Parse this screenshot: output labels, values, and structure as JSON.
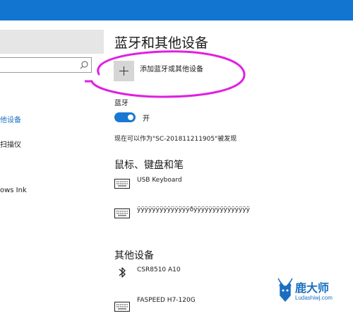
{
  "sidebar": {
    "items": [
      {
        "label": "他设备",
        "active": true
      },
      {
        "label": "扫描仪",
        "active": false
      },
      {
        "label": "ows Ink",
        "active": false
      }
    ]
  },
  "page": {
    "title": "蓝牙和其他设备",
    "add_device_label": "添加蓝牙或其他设备",
    "bluetooth_label": "蓝牙",
    "toggle_state": "开",
    "discoverable_text": "现在可以作为\"SC-201811211905\"被发现"
  },
  "sections": {
    "mouse_keyboard_pen": {
      "heading": "鼠标、键盘和笔",
      "devices": [
        {
          "name": "USB Keyboard",
          "icon": "keyboard-icon"
        },
        {
          "name": "ÿÿÿÿÿÿÿÿÿÿÿÿÿÿðÿÿÿÿÿÿÿÿÿÿÿÿÿÿÿ",
          "icon": "keyboard-icon"
        }
      ]
    },
    "other_devices": {
      "heading": "其他设备",
      "devices": [
        {
          "name": "CSR8510 A10",
          "icon": "bluetooth-icon"
        },
        {
          "name": "FASPEED H7-120G",
          "icon": "keyboard-icon"
        }
      ]
    }
  },
  "watermark": {
    "title": "鹿大师",
    "url": "Ludashiwj.com"
  },
  "colors": {
    "accent": "#1a6fc0",
    "topbar": "#1275d0",
    "annotation": "#e020e0"
  }
}
